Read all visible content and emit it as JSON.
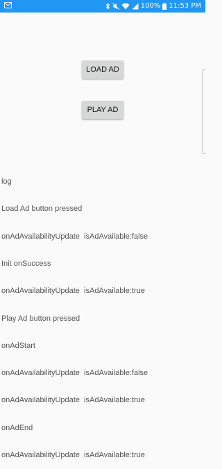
{
  "status_bar": {
    "battery_percent": "100%",
    "time": "11:53 PM",
    "icons": [
      "mail-icon",
      "bluetooth-icon",
      "mute-icon",
      "wifi-icon",
      "signal-icon",
      "battery-icon"
    ],
    "background_color": "#2196f3"
  },
  "buttons": {
    "load_ad": "LOAD AD",
    "play_ad": "PLAY AD"
  },
  "log": {
    "lines": [
      "log",
      "Load Ad button pressed",
      "onAdAvailabilityUpdate  isAdAvailable:false",
      "Init onSuccess",
      "onAdAvailabilityUpdate  isAdAvailable:true",
      "Play Ad button pressed",
      "onAdStart",
      "onAdAvailabilityUpdate  isAdAvailable:false",
      "onAdAvailabilityUpdate  isAdAvailable:true",
      "onAdEnd",
      "onAdAvailabilityUpdate  isAdAvailable:true"
    ]
  }
}
